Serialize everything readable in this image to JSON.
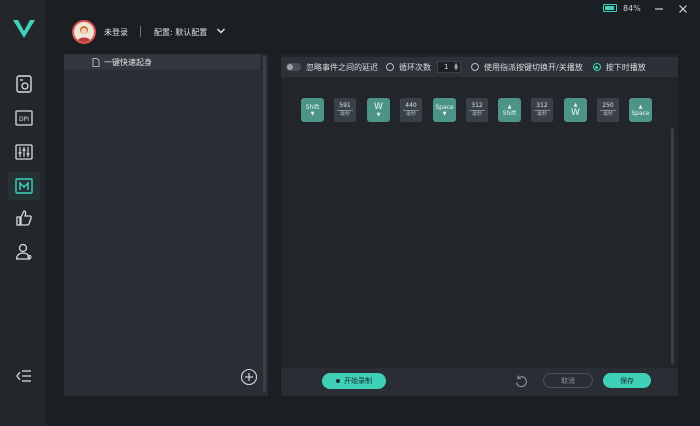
{
  "header": {
    "user_status": "未登录",
    "config_label": "配置: 默认配置",
    "battery_percent": "84%"
  },
  "sidebar": {
    "items": [
      {
        "name": "mouse-settings"
      },
      {
        "name": "dpi"
      },
      {
        "name": "equalizer"
      },
      {
        "name": "macro"
      },
      {
        "name": "like"
      },
      {
        "name": "user"
      }
    ]
  },
  "macros": {
    "items": [
      {
        "label": "一键快速起身"
      }
    ]
  },
  "options": {
    "ignore_delay": "忽略事件之间的延迟",
    "loop_count_label": "循环次数",
    "loop_count_value": "1",
    "toggle_mode": "使用指派按键切换开/关播放",
    "press_mode": "按下时播放"
  },
  "sequence": {
    "unit": "毫秒",
    "steps": [
      {
        "type": "key",
        "label": "Shift",
        "dir": "down"
      },
      {
        "type": "delay",
        "value": "591"
      },
      {
        "type": "key",
        "label": "W",
        "dir": "down"
      },
      {
        "type": "delay",
        "value": "440"
      },
      {
        "type": "key",
        "label": "Space",
        "dir": "down"
      },
      {
        "type": "delay",
        "value": "312"
      },
      {
        "type": "key",
        "label": "Shift",
        "dir": "up"
      },
      {
        "type": "delay",
        "value": "312"
      },
      {
        "type": "key",
        "label": "W",
        "dir": "up"
      },
      {
        "type": "delay",
        "value": "250"
      },
      {
        "type": "key",
        "label": "Space",
        "dir": "up"
      }
    ]
  },
  "footer": {
    "record_label": "开始录制",
    "cancel_label": "取消",
    "save_label": "保存"
  },
  "colors": {
    "accent": "#3fd1b8",
    "key_bg": "#4d9488"
  }
}
